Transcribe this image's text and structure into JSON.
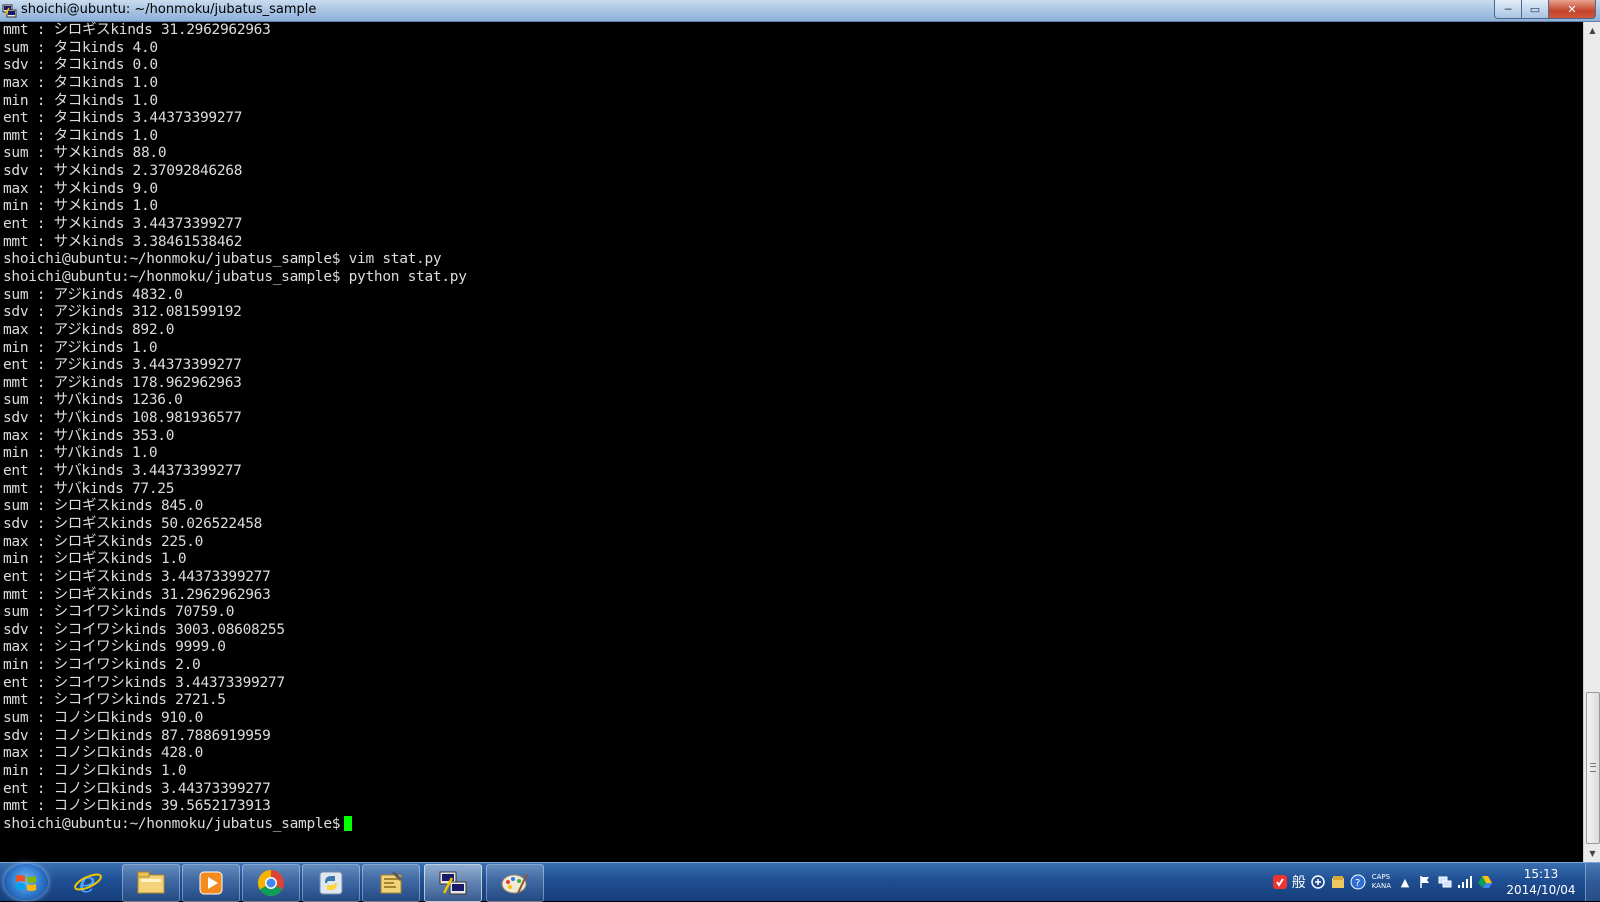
{
  "window": {
    "title": "shoichi@ubuntu: ~/honmoku/jubatus_sample",
    "minimize_label": "─",
    "maximize_label": "▭",
    "close_label": "✕"
  },
  "terminal": {
    "lines": [
      "mmt : シロギスkinds 31.2962962963",
      "sum : タコkinds 4.0",
      "sdv : タコkinds 0.0",
      "max : タコkinds 1.0",
      "min : タコkinds 1.0",
      "ent : タコkinds 3.44373399277",
      "mmt : タコkinds 1.0",
      "sum : サメkinds 88.0",
      "sdv : サメkinds 2.37092846268",
      "max : サメkinds 9.0",
      "min : サメkinds 1.0",
      "ent : サメkinds 3.44373399277",
      "mmt : サメkinds 3.38461538462",
      "shoichi@ubuntu:~/honmoku/jubatus_sample$ vim stat.py",
      "shoichi@ubuntu:~/honmoku/jubatus_sample$ python stat.py",
      "sum : アジkinds 4832.0",
      "sdv : アジkinds 312.081599192",
      "max : アジkinds 892.0",
      "min : アジkinds 1.0",
      "ent : アジkinds 3.44373399277",
      "mmt : アジkinds 178.962962963",
      "sum : サバkinds 1236.0",
      "sdv : サバkinds 108.981936577",
      "max : サバkinds 353.0",
      "min : サバkinds 1.0",
      "ent : サバkinds 3.44373399277",
      "mmt : サバkinds 77.25",
      "sum : シロギスkinds 845.0",
      "sdv : シロギスkinds 50.026522458",
      "max : シロギスkinds 225.0",
      "min : シロギスkinds 1.0",
      "ent : シロギスkinds 3.44373399277",
      "mmt : シロギスkinds 31.2962962963",
      "sum : シコイワシkinds 70759.0",
      "sdv : シコイワシkinds 3003.08608255",
      "max : シコイワシkinds 9999.0",
      "min : シコイワシkinds 2.0",
      "ent : シコイワシkinds 3.44373399277",
      "mmt : シコイワシkinds 2721.5",
      "sum : コノシロkinds 910.0",
      "sdv : コノシロkinds 87.7886919959",
      "max : コノシロkinds 428.0",
      "min : コノシロkinds 1.0",
      "ent : コノシロkinds 3.44373399277",
      "mmt : コノシロkinds 39.5652173913"
    ],
    "prompt": "shoichi@ubuntu:~/honmoku/jubatus_sample$",
    "cursor_color": "#00ff00",
    "text_color": "#dcdcdc",
    "background": "#000000"
  },
  "taskbar": {
    "pinned": [
      {
        "name": "internet-explorer-icon"
      },
      {
        "name": "file-explorer-icon"
      },
      {
        "name": "media-player-icon"
      },
      {
        "name": "chrome-icon"
      },
      {
        "name": "python-icon"
      },
      {
        "name": "app-tool-icon"
      },
      {
        "name": "putty-icon",
        "active": true
      },
      {
        "name": "paint-icon"
      }
    ],
    "tray": {
      "ime_label": "般",
      "caps_label": "CAPS",
      "kana_label": "KANA",
      "time": "15:13",
      "date": "2014/10/04"
    }
  }
}
